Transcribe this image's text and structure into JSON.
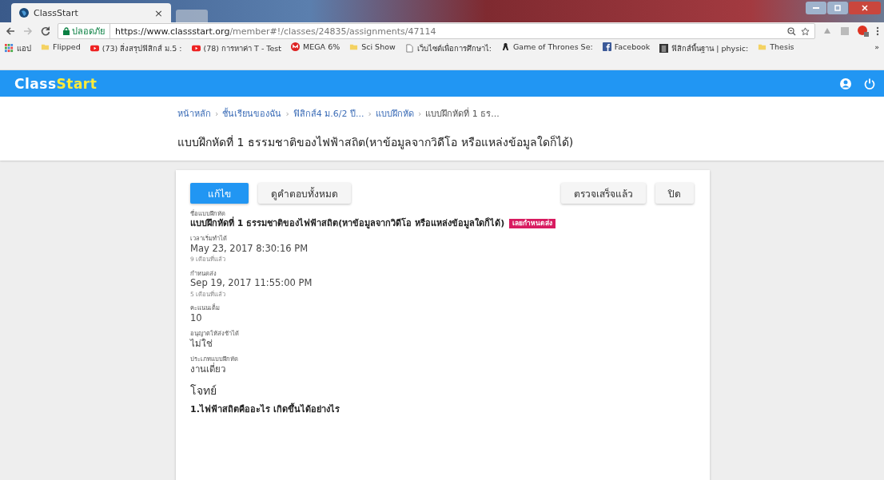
{
  "browser": {
    "tab": {
      "title": "ClassStart",
      "close": "×"
    },
    "security": "ปลอดภัย",
    "url_host": "https://www.classstart.org",
    "url_path": "/member#!/classes/24835/assignments/47114",
    "bookmarks": [
      {
        "kind": "apps",
        "label": "แอป"
      },
      {
        "kind": "folder",
        "label": "Flipped"
      },
      {
        "kind": "video",
        "label": "(73) สิ่งสรุปฟิสิกส์ ม.5 :"
      },
      {
        "kind": "video",
        "label": "(78) การหาค่า T - Test"
      },
      {
        "kind": "mega",
        "label": "MEGA 6%"
      },
      {
        "kind": "folder",
        "label": "Sci Show"
      },
      {
        "kind": "page",
        "label": "เว็บไซต์เพื่อการศึกษาไ:"
      },
      {
        "kind": "ribbon",
        "label": "Game of Thrones Se:"
      },
      {
        "kind": "facebook",
        "label": "Facebook"
      },
      {
        "kind": "photo",
        "label": "ฟิสิกส์พื้นฐาน | physic:"
      },
      {
        "kind": "folder",
        "label": "Thesis"
      }
    ],
    "more": "»"
  },
  "app": {
    "logo_a": "Class",
    "logo_b": "Start"
  },
  "breadcrumbs": [
    {
      "label": "หน้าหลัก",
      "link": true
    },
    {
      "separator": "›",
      "label": "ชั้นเรียนของฉัน",
      "link": true
    },
    {
      "separator": "›",
      "label": "ฟิสิกส์4 ม.6/2 ปี...",
      "link": true
    },
    {
      "separator": "›",
      "label": "แบบฝึกหัด",
      "link": true
    },
    {
      "separator": "›",
      "label": "แบบฝึกหัดที่ 1 ธร...",
      "link": false
    }
  ],
  "page_title": "แบบฝึกหัดที่ 1 ธรรมชาติของไฟฟ้าสถิต(หาข้อมูลจากวิดีโอ หรือแหล่งข้อมูลใดก็ได้)",
  "actions_left": [
    {
      "label": "แก้ไข",
      "primary": true
    },
    {
      "label": "ดูคำตอบทั้งหมด",
      "primary": false
    }
  ],
  "actions_right": [
    {
      "label": "ตรวจเสร็จแล้ว",
      "primary": false
    },
    {
      "label": "ปิด",
      "primary": false
    }
  ],
  "fields": [
    {
      "label": "ชื่อแบบฝึกหัด",
      "value": "แบบฝึกหัดที่ 1 ธรรมชาติของไฟฟ้าสถิต(หาข้อมูลจากวิดีโอ หรือแหล่งข้อมูลใดก็ได้)",
      "bold": true,
      "badge": "เลยกำหนดส่ง"
    },
    {
      "label": "เวลาเริ่มทำได้",
      "value": "May 23, 2017 8:30:16 PM",
      "bold": false,
      "note": "9 เดือนที่แล้ว"
    },
    {
      "label": "กำหนดส่ง",
      "value": "Sep 19, 2017 11:55:00 PM",
      "bold": false,
      "note": "5 เดือนที่แล้ว"
    },
    {
      "label": "คะแนนเต็ม",
      "value": "10",
      "bold": false
    },
    {
      "label": "อนุญาตให้ส่งช้าได้",
      "value": "ไม่ใช่",
      "bold": false
    },
    {
      "label": "ประเภทแบบฝึกหัด",
      "value": "งานเดี่ยว",
      "bold": false
    }
  ],
  "section_title": "โจทย์",
  "question": "1.ไฟฟ้าสถิตคืออะไร เกิดขึ้นได้อย่างไร"
}
